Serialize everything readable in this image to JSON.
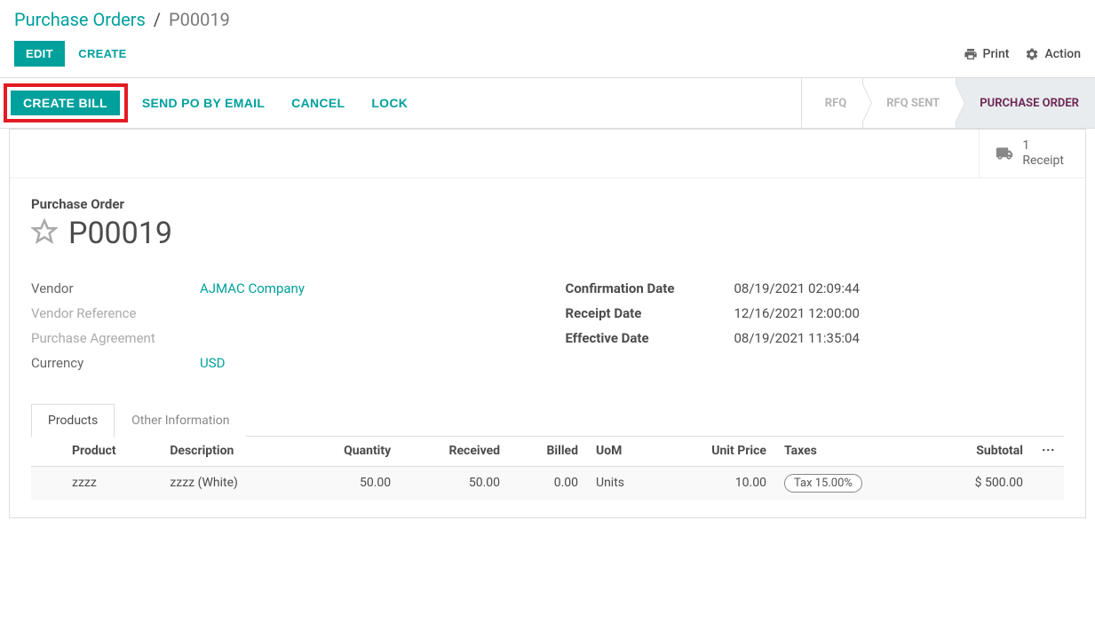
{
  "breadcrumb": {
    "root": "Purchase Orders",
    "current": "P00019"
  },
  "toolbar": {
    "edit": "EDIT",
    "create": "CREATE",
    "print": "Print",
    "action": "Action"
  },
  "statusbar": {
    "create_bill": "CREATE BILL",
    "send_po": "SEND PO BY EMAIL",
    "cancel": "CANCEL",
    "lock": "LOCK",
    "steps": {
      "rfq": "RFQ",
      "rfq_sent": "RFQ SENT",
      "po": "PURCHASE ORDER"
    }
  },
  "stat": {
    "count": "1",
    "label": "Receipt"
  },
  "header": {
    "label": "Purchase Order",
    "name": "P00019"
  },
  "fields_left": {
    "vendor_label": "Vendor",
    "vendor_value": "AJMAC Company",
    "vendor_ref_label": "Vendor Reference",
    "vendor_ref_value": "",
    "agreement_label": "Purchase Agreement",
    "agreement_value": "",
    "currency_label": "Currency",
    "currency_value": "USD"
  },
  "fields_right": {
    "conf_label": "Confirmation Date",
    "conf_value": "08/19/2021 02:09:44",
    "receipt_label": "Receipt Date",
    "receipt_value": "12/16/2021 12:00:00",
    "eff_label": "Effective Date",
    "eff_value": "08/19/2021 11:35:04"
  },
  "tabs": {
    "products": "Products",
    "other": "Other Information"
  },
  "table": {
    "headers": {
      "product": "Product",
      "description": "Description",
      "quantity": "Quantity",
      "received": "Received",
      "billed": "Billed",
      "uom": "UoM",
      "unit_price": "Unit Price",
      "taxes": "Taxes",
      "subtotal": "Subtotal"
    },
    "rows": [
      {
        "product": "zzzz",
        "description": "zzzz (White)",
        "quantity": "50.00",
        "received": "50.00",
        "billed": "0.00",
        "uom": "Units",
        "unit_price": "10.00",
        "taxes": "Tax 15.00%",
        "subtotal": "$ 500.00"
      }
    ]
  }
}
